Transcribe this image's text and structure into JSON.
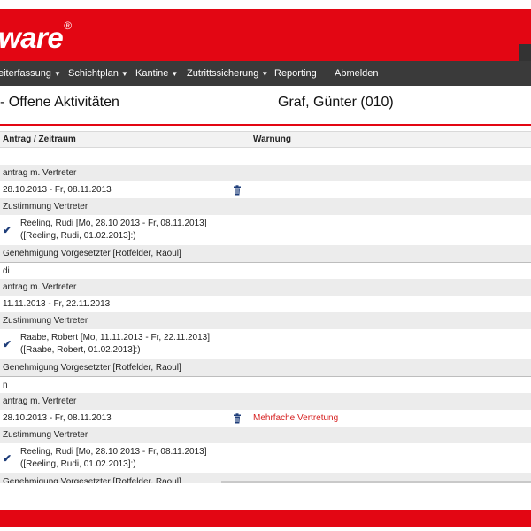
{
  "brand": {
    "logo_text": "ware",
    "logo_mark": "®",
    "accent_color": "#e30613"
  },
  "nav": {
    "items": [
      {
        "label": "eiterfassung",
        "has_dropdown": true
      },
      {
        "label": "Schichtplan",
        "has_dropdown": true
      },
      {
        "label": "Kantine",
        "has_dropdown": true
      },
      {
        "label": "Zutrittssicherung",
        "has_dropdown": true
      },
      {
        "label": "Reporting",
        "has_dropdown": false
      },
      {
        "label": "Abmelden",
        "has_dropdown": false
      }
    ],
    "caret": "▼"
  },
  "header": {
    "title": "- Offene Aktivitäten",
    "person": "Graf, Günter (010)"
  },
  "table": {
    "columns": [
      "Antrag / Zeitraum",
      "Warnung"
    ],
    "rows": [
      {
        "text": "",
        "shade": false
      },
      {
        "text": "antrag m. Vertreter",
        "shade": true
      },
      {
        "text": "28.10.2013 - Fr, 08.11.2013",
        "shade": false,
        "trash": true
      },
      {
        "text": "Zustimmung Vertreter",
        "shade": true
      },
      {
        "text": "Reeling, Rudi [Mo, 28.10.2013 - Fr, 08.11.2013] ([Reeling, Rudi, 01.02.2013]:)",
        "shade": false,
        "check": true
      },
      {
        "text": "Genehmigung Vorgesetzter [Rotfelder, Raoul]",
        "shade": true
      },
      {
        "text": "di",
        "shade": false,
        "group_start": true
      },
      {
        "text": "antrag m. Vertreter",
        "shade": true
      },
      {
        "text": "11.11.2013 - Fr, 22.11.2013",
        "shade": false
      },
      {
        "text": "Zustimmung Vertreter",
        "shade": true
      },
      {
        "text": "Raabe, Robert [Mo, 11.11.2013 - Fr, 22.11.2013] ([Raabe, Robert, 01.02.2013]:)",
        "shade": false,
        "check": true
      },
      {
        "text": "Genehmigung Vorgesetzter [Rotfelder, Raoul]",
        "shade": true
      },
      {
        "text": "n",
        "shade": false,
        "group_start": true
      },
      {
        "text": "antrag m. Vertreter",
        "shade": true
      },
      {
        "text": "28.10.2013 - Fr, 08.11.2013",
        "shade": false,
        "trash": true,
        "warning": "Mehrfache Vertretung"
      },
      {
        "text": "Zustimmung Vertreter",
        "shade": true
      },
      {
        "text": "Reeling, Rudi [Mo, 28.10.2013 - Fr, 08.11.2013] ([Reeling, Rudi, 01.02.2013]:)",
        "shade": false,
        "check": true
      },
      {
        "text": "Genehmigung Vorgesetzter [Rotfelder, Raoul]",
        "shade": true
      }
    ]
  },
  "icons": {
    "check": "✔",
    "trash": "trash-icon"
  },
  "colors": {
    "nav_bg": "#3a3a3a",
    "check": "#1f3e7a",
    "trash": "#1f3e7a",
    "warning": "#d62020"
  }
}
